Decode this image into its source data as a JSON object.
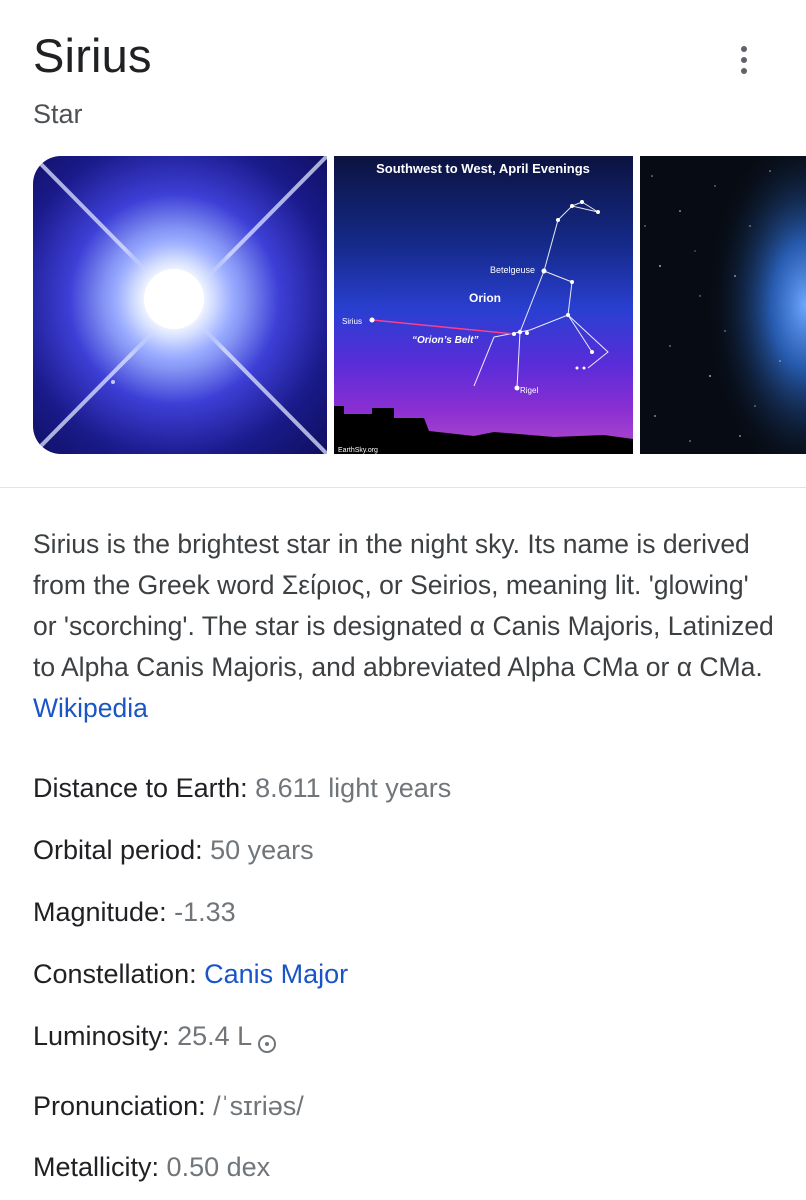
{
  "header": {
    "title": "Sirius",
    "subtitle": "Star"
  },
  "menu": {
    "icon": "more-vert-icon"
  },
  "images": [
    {
      "name": "sirius-star-photo"
    },
    {
      "name": "orion-sky-chart",
      "heading": "Southwest to West, April Evenings",
      "labels": {
        "betelgeuse": "Betelgeuse",
        "orion": "Orion",
        "sirius": "Sirius",
        "belt": "“Orion’s Belt”",
        "rigel": "Rigel",
        "credit": "EarthSky.org"
      }
    },
    {
      "name": "starfield-photo"
    }
  ],
  "description": {
    "text": "Sirius is the brightest star in the night sky. Its name is derived from the Greek word Σείριος, or Seirios, meaning lit. 'glowing' or 'scorching'. The star is designated α Canis Majoris, Latinized to Alpha Canis Majoris, and abbreviated Alpha CMa or α CMa.",
    "source": "Wikipedia"
  },
  "facts": [
    {
      "label": "Distance to Earth:",
      "value": "8.611 light years"
    },
    {
      "label": "Orbital period:",
      "value": "50 years"
    },
    {
      "label": "Magnitude:",
      "value": "-1.33"
    },
    {
      "label": "Constellation:",
      "value": "Canis Major"
    },
    {
      "label": "Luminosity:",
      "value": "25.4 L"
    },
    {
      "label": "Pronunciation:",
      "value": "/ˈsɪriəs/"
    },
    {
      "label": "Metallicity:",
      "value": "0.50 dex"
    }
  ],
  "colors": {
    "link": "#1a55c7",
    "label": "#202124",
    "value": "#70757a"
  }
}
